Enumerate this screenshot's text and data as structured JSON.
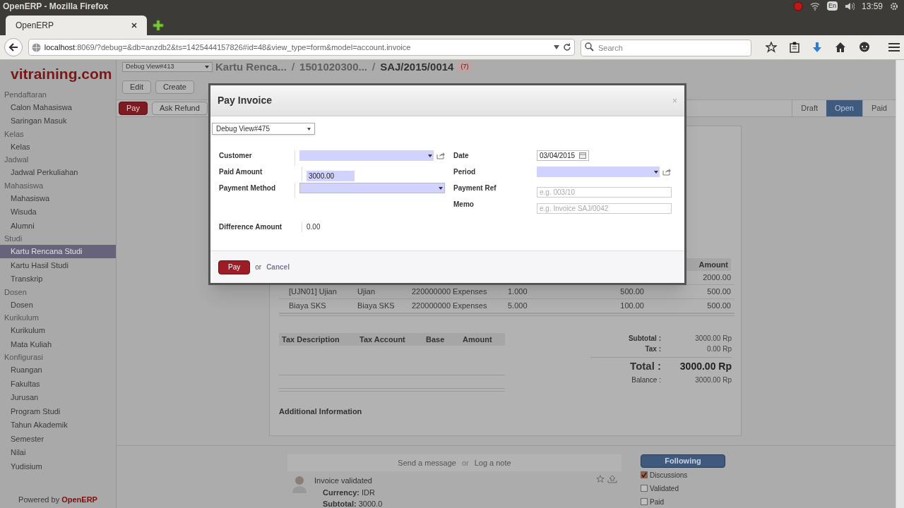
{
  "os_bar": {
    "title": "OpenERP - Mozilla Firefox",
    "keyboard": "En",
    "clock": "13:59"
  },
  "browser": {
    "tab": {
      "title": "OpenERP"
    },
    "url": {
      "host": "localhost",
      "rest": ":8069/?debug=&db=anzdb2&ts=1425444157826#id=48&view_type=form&model=account.invoice"
    },
    "search": {
      "placeholder": "Search"
    }
  },
  "logo": "vitraining.com",
  "sidebar": {
    "sections": [
      {
        "title": "Pendaftaran",
        "items": [
          {
            "label": "Calon Mahasiswa",
            "selected": false
          },
          {
            "label": "Saringan Masuk",
            "selected": false
          }
        ]
      },
      {
        "title": "Kelas",
        "items": [
          {
            "label": "Kelas",
            "selected": false
          }
        ]
      },
      {
        "title": "Jadwal",
        "items": [
          {
            "label": "Jadwal Perkuliahan",
            "selected": false
          }
        ]
      },
      {
        "title": "Mahasiswa",
        "items": [
          {
            "label": "Mahasiswa",
            "selected": false
          },
          {
            "label": "Wisuda",
            "selected": false
          },
          {
            "label": "Alumni",
            "selected": false
          }
        ]
      },
      {
        "title": "Studi",
        "items": [
          {
            "label": "Kartu Rencana Studi",
            "selected": true
          },
          {
            "label": "Kartu Hasil Studi",
            "selected": false
          },
          {
            "label": "Transkrip",
            "selected": false
          }
        ]
      },
      {
        "title": "Dosen",
        "items": [
          {
            "label": "Dosen",
            "selected": false
          }
        ]
      },
      {
        "title": "Kurikulum",
        "items": [
          {
            "label": "Kurikulum",
            "selected": false
          },
          {
            "label": "Mata Kuliah",
            "selected": false
          }
        ]
      },
      {
        "title": "Konfigurasi",
        "items": [
          {
            "label": "Ruangan",
            "selected": false
          },
          {
            "label": "Fakultas",
            "selected": false
          },
          {
            "label": "Jurusan",
            "selected": false
          },
          {
            "label": "Program Studi",
            "selected": false
          },
          {
            "label": "Tahun Akademik",
            "selected": false
          },
          {
            "label": "Semester",
            "selected": false
          },
          {
            "label": "Nilai",
            "selected": false
          },
          {
            "label": "Yudisium",
            "selected": false
          }
        ]
      }
    ],
    "footer": {
      "text": "Powered by",
      "brand": "OpenERP"
    }
  },
  "view_selector": "Debug View#413",
  "breadcrumbs": [
    "Kartu Renca...",
    "1501020300...",
    "SAJ/2015/0014"
  ],
  "breadcrumb_separator": "/",
  "badge": "(7)",
  "toolbar": [
    "Edit",
    "Create"
  ],
  "actions": [
    {
      "label": "Pay",
      "kind": "primary"
    },
    {
      "label": "Ask Refund",
      "kind": "default"
    }
  ],
  "stages": [
    {
      "label": "Draft",
      "selected": false
    },
    {
      "label": "Open",
      "selected": true
    },
    {
      "label": "Paid",
      "selected": false
    }
  ],
  "invoice_lines": {
    "amount_header": "Amount",
    "rows": [
      {
        "cells": [
          "",
          "",
          "",
          "",
          "",
          "2000.00"
        ]
      },
      {
        "cells": [
          "[UJN01] Ujian",
          "Ujian",
          "220000000 Expenses",
          "1.000",
          "500.00",
          "500.00"
        ]
      },
      {
        "cells": [
          "Biaya SKS",
          "Biaya SKS",
          "220000000 Expenses",
          "5.000",
          "100.00",
          "500.00"
        ]
      }
    ]
  },
  "tax_table": {
    "columns": [
      "Tax Description",
      "Tax Account",
      "Base",
      "Amount"
    ]
  },
  "totals": [
    {
      "label": "Subtotal :",
      "value": "3000.00 Rp",
      "kind": "small"
    },
    {
      "label": "Tax :",
      "value": "0.00 Rp",
      "kind": "small"
    },
    {
      "label": "Total :",
      "value": "3000.00 Rp",
      "kind": "big"
    },
    {
      "label": "Balance :",
      "value": "3000.00 Rp",
      "kind": "plain"
    }
  ],
  "additional_info": "Additional Information",
  "chatter": {
    "send": "Send a message",
    "or": "or",
    "log": "Log a note",
    "message": {
      "title": "Invoice validated",
      "lines": [
        "**Currency:** IDR",
        "**Subtotal:** 3000.0"
      ]
    }
  },
  "followers": {
    "button": "Following",
    "subtypes": [
      {
        "label": "Discussions",
        "checked": true
      },
      {
        "label": "Validated",
        "checked": false
      },
      {
        "label": "Paid",
        "checked": false
      }
    ]
  },
  "dialog": {
    "title": "Pay Invoice",
    "close": "×",
    "view_selector": "Debug View#475",
    "left_fields": [
      {
        "label": "Customer",
        "kind": "many2one",
        "required": true
      },
      {
        "label": "Paid Amount",
        "kind": "input",
        "required": true,
        "value": "3000.00"
      },
      {
        "label": "Payment Method",
        "kind": "select",
        "required": true
      }
    ],
    "right_fields": [
      {
        "label": "Date",
        "kind": "date",
        "required": false,
        "value": "03/04/2015"
      },
      {
        "label": "Period",
        "kind": "many2one",
        "required": true
      },
      {
        "label": "Payment Ref",
        "kind": "input",
        "required": false,
        "placeholder": "e.g. 003/10"
      },
      {
        "label": "Memo",
        "kind": "input",
        "required": false,
        "placeholder": "e.g. Invoice SAJ/0042"
      }
    ],
    "difference": {
      "label": "Difference Amount",
      "value": "0.00"
    },
    "pay": "Pay",
    "or": "or",
    "cancel": "Cancel"
  }
}
